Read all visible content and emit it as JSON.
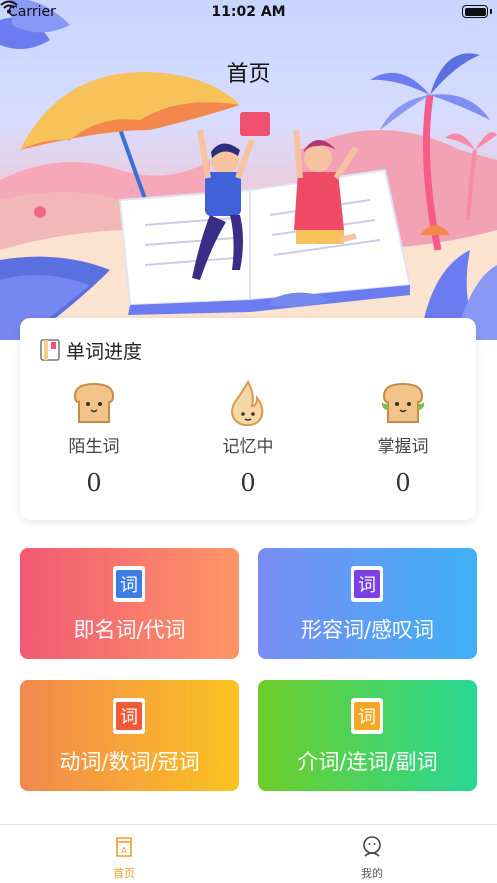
{
  "status_bar": {
    "carrier": "Carrier",
    "time": "11:02 AM"
  },
  "header": {
    "title": "首页"
  },
  "progress_card": {
    "title": "单词进度",
    "stats": [
      {
        "label": "陌生词",
        "value": "0",
        "icon": "bread-icon"
      },
      {
        "label": "记忆中",
        "value": "0",
        "icon": "flame-icon"
      },
      {
        "label": "掌握词",
        "value": "0",
        "icon": "sandwich-icon"
      }
    ]
  },
  "categories": [
    {
      "label": "即名词/代词",
      "icon": "word-card-icon",
      "icon_color": "#3b7fe6"
    },
    {
      "label": "形容词/感叹词",
      "icon": "word-card-icon",
      "icon_color": "#7b3fe4"
    },
    {
      "label": "动词/数词/冠词",
      "icon": "word-card-icon",
      "icon_color": "#ef5a3a"
    },
    {
      "label": "介词/连词/副词",
      "icon": "word-card-icon",
      "icon_color": "#f5a623"
    }
  ],
  "tabbar": {
    "items": [
      {
        "label": "首页",
        "icon": "book-tab-icon",
        "active": true
      },
      {
        "label": "我的",
        "icon": "profile-icon",
        "active": false
      }
    ],
    "accent": "#f59b2a"
  }
}
